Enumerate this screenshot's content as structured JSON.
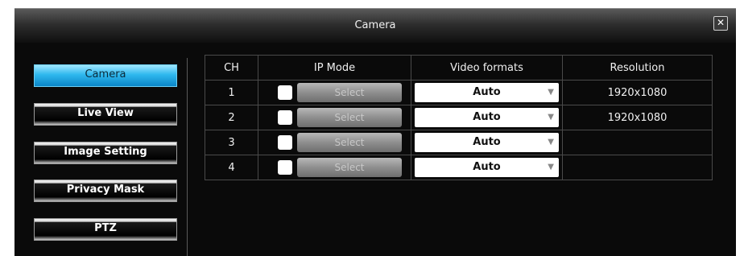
{
  "window": {
    "title": "Camera",
    "close_symbol": "✕"
  },
  "sidebar": {
    "items": [
      {
        "label": "Camera",
        "active": true
      },
      {
        "label": "Live View",
        "active": false
      },
      {
        "label": "Image Setting",
        "active": false
      },
      {
        "label": "Privacy Mask",
        "active": false
      },
      {
        "label": "PTZ",
        "active": false
      }
    ]
  },
  "table": {
    "headers": [
      "CH",
      "IP Mode",
      "Video formats",
      "Resolution"
    ],
    "rows": [
      {
        "ch": "1",
        "select_label": "Select",
        "format": "Auto",
        "resolution": "1920x1080"
      },
      {
        "ch": "2",
        "select_label": "Select",
        "format": "Auto",
        "resolution": "1920x1080"
      },
      {
        "ch": "3",
        "select_label": "Select",
        "format": "Auto",
        "resolution": ""
      },
      {
        "ch": "4",
        "select_label": "Select",
        "format": "Auto",
        "resolution": ""
      }
    ]
  },
  "icons": {
    "dropdown": "chevron-down-icon",
    "close": "close-icon"
  }
}
